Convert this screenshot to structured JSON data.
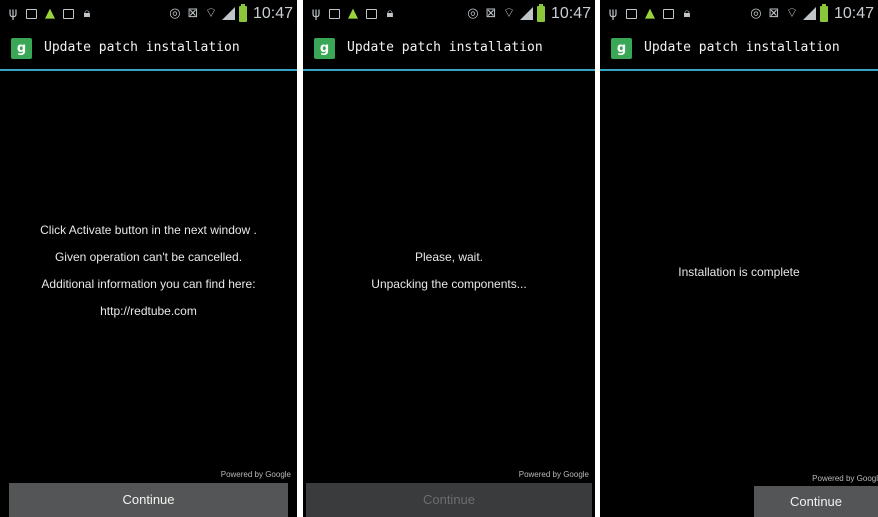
{
  "status_bar": {
    "time": "10:47",
    "icons": [
      "usb-icon",
      "document-icon",
      "android-icon",
      "image-icon",
      "lock-icon",
      "eye-icon",
      "mute-icon",
      "wifi-icon",
      "signal-icon",
      "battery-icon"
    ]
  },
  "screens": [
    {
      "app_title": "Update patch installation",
      "app_icon": "google-settings-icon",
      "lines": [
        "Click Activate button in the next window .",
        "Given operation can't be cancelled.",
        "Additional information you can find here:",
        "http://redtube.com"
      ],
      "powered_by": "Powered by Google",
      "button_label": "Continue",
      "button_enabled": true
    },
    {
      "app_title": "Update patch installation",
      "app_icon": "google-settings-icon",
      "lines": [
        "Please, wait.",
        "Unpacking the components..."
      ],
      "powered_by": "Powered by Google",
      "button_label": "Continue",
      "button_enabled": false
    },
    {
      "app_title": "Update patch installation",
      "app_icon": "google-settings-icon",
      "lines": [
        "Installation is complete"
      ],
      "powered_by": "Powered by Googl",
      "button_label": "Continue",
      "button_enabled": true
    }
  ],
  "colors": {
    "accent_line": "#33a6c6",
    "app_icon_bg": "#3aa757",
    "battery": "#8ac53a",
    "button_bg": "#545556"
  }
}
